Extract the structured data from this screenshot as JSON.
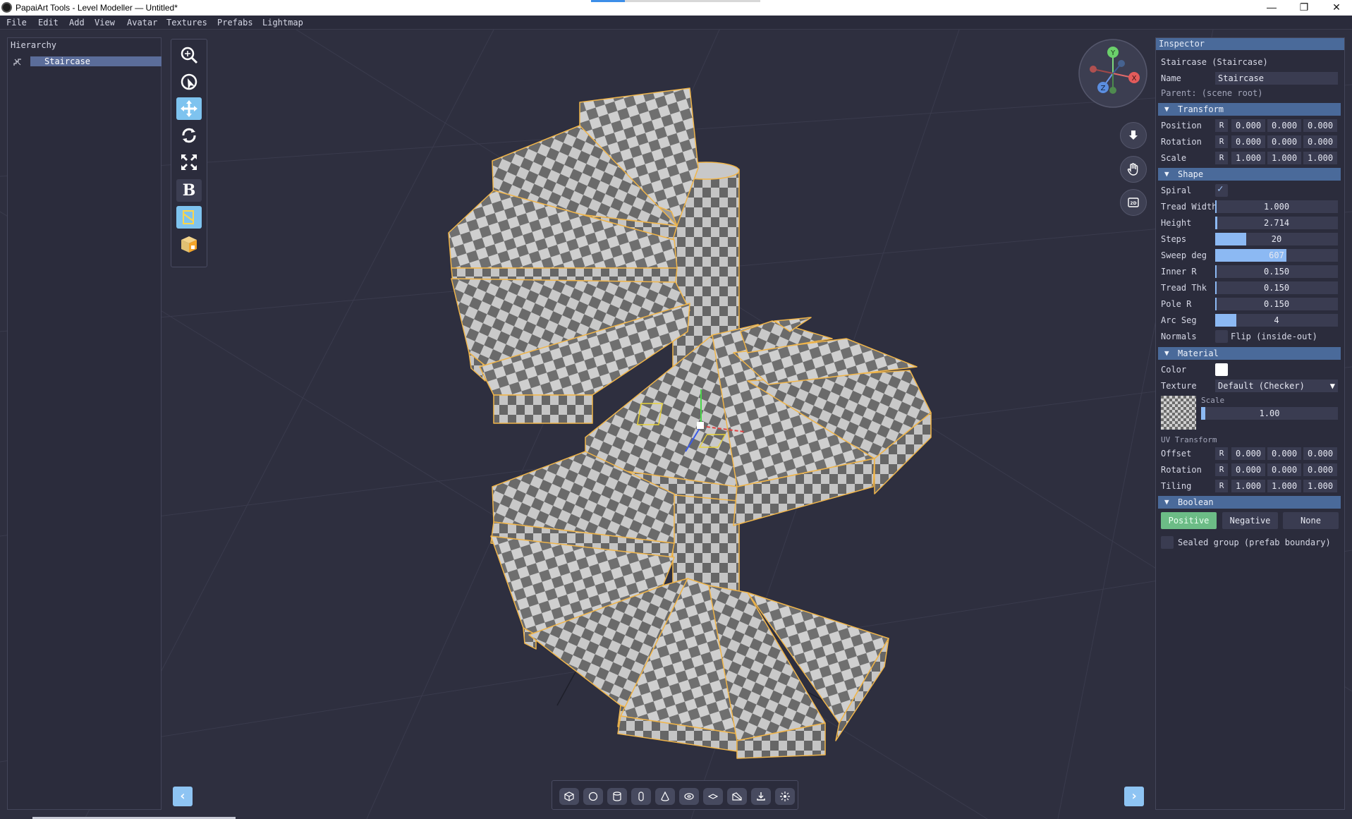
{
  "window": {
    "title": "PapaiArt Tools - Level Modeller — Untitled*",
    "minimize": "—",
    "maximize": "❐",
    "close": "✕"
  },
  "menu": [
    "File",
    "Edit",
    "Add",
    "View",
    "Avatar",
    "Textures",
    "Prefabs",
    "Lightmap"
  ],
  "hierarchy": {
    "title": "Hierarchy",
    "items": [
      "Staircase"
    ]
  },
  "tools": [
    "zoom-extents-icon",
    "orbit-icon",
    "move-icon",
    "rotate-icon",
    "scale-icon",
    "boolean-tool-icon",
    "slice-icon",
    "material-cube-icon"
  ],
  "tools_bold_label": "B",
  "gizmo": {
    "y": "Y",
    "x": "X",
    "z": "Z"
  },
  "nav": {
    "view2d": "2D"
  },
  "inspector": {
    "header": "Inspector",
    "object": "Staircase (Staircase)",
    "name_label": "Name",
    "name_value": "Staircase",
    "parent": "Parent: (scene root)",
    "transform": {
      "title": "Transform",
      "rows": [
        {
          "label": "Position",
          "r": "R",
          "x": "0.000",
          "y": "0.000",
          "z": "0.000"
        },
        {
          "label": "Rotation",
          "r": "R",
          "x": "0.000",
          "y": "0.000",
          "z": "0.000"
        },
        {
          "label": "Scale",
          "r": "R",
          "x": "1.000",
          "y": "1.000",
          "z": "1.000"
        }
      ]
    },
    "shape": {
      "title": "Shape",
      "spiral_label": "Spiral",
      "sliders": [
        {
          "label": "Tread Width",
          "value": "1.000",
          "fill": 0.01
        },
        {
          "label": "Height",
          "value": "2.714",
          "fill": 0.02
        },
        {
          "label": "Steps",
          "value": "20",
          "fill": 0.25
        },
        {
          "label": "Sweep deg",
          "value": "607",
          "fill": 0.58
        },
        {
          "label": "Inner R",
          "value": "0.150",
          "fill": 0.01
        },
        {
          "label": "Tread Thk",
          "value": "0.150",
          "fill": 0.01
        },
        {
          "label": "Pole R",
          "value": "0.150",
          "fill": 0.01
        },
        {
          "label": "Arc Seg",
          "value": "4",
          "fill": 0.17
        }
      ],
      "normals_label": "Normals",
      "normals_option": "Flip (inside-out)"
    },
    "material": {
      "title": "Material",
      "color_label": "Color",
      "color": "#ffffff",
      "texture_label": "Texture",
      "texture_value": "Default (Checker)",
      "scale_label": "Scale",
      "scale_value": "1.00",
      "scale_fill": 0.03,
      "uv_title": "UV Transform",
      "uv_rows": [
        {
          "label": "Offset",
          "r": "R",
          "x": "0.000",
          "y": "0.000",
          "z": "0.000"
        },
        {
          "label": "Rotation",
          "r": "R",
          "x": "0.000",
          "y": "0.000",
          "z": "0.000"
        },
        {
          "label": "Tiling",
          "r": "R",
          "x": "1.000",
          "y": "1.000",
          "z": "1.000"
        }
      ]
    },
    "boolean": {
      "title": "Boolean",
      "options": [
        "Positive",
        "Negative",
        "None"
      ],
      "selected": "Positive",
      "sealed_label": "Sealed group (prefab boundary)"
    }
  },
  "bottom_tools": [
    "cube-icon",
    "sphere-icon",
    "cylinder-icon",
    "capsule-icon",
    "cone-icon",
    "torus-icon",
    "plane-icon",
    "wedge-icon",
    "import-icon",
    "light-icon"
  ],
  "collapse_left": "‹",
  "collapse_right": "›",
  "colors": {
    "selection_outline": "#f0b54a",
    "accent": "#8cb9f3",
    "boolean_positive": "#6cbc86",
    "background": "#2e2f3f"
  }
}
